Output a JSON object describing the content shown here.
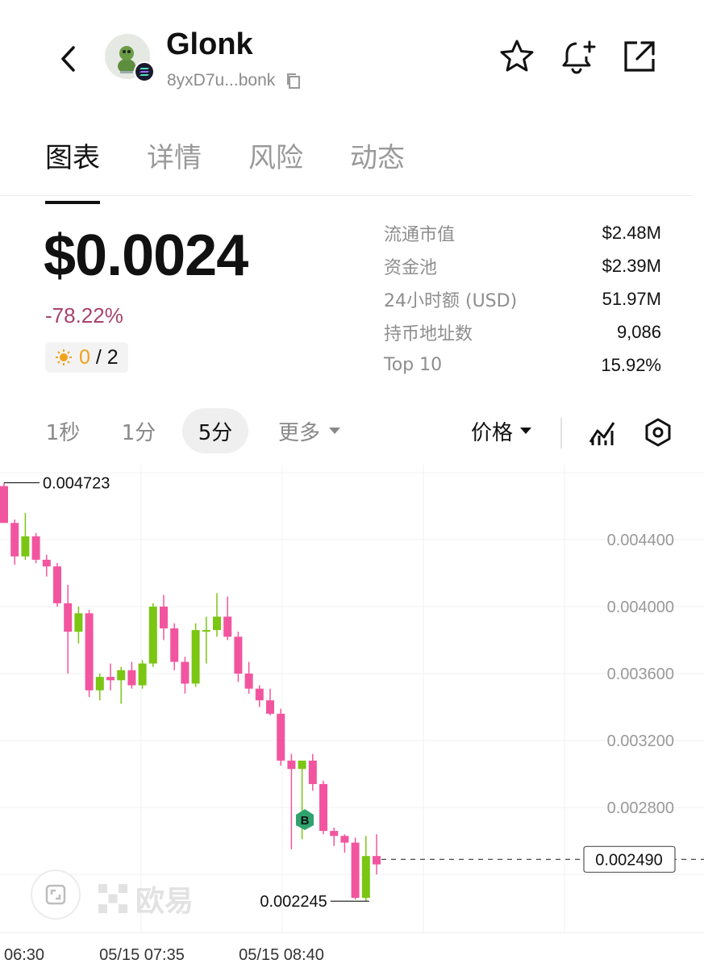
{
  "header": {
    "token_name": "Glonk",
    "address": "8yxD7u...bonk",
    "icons": [
      "back-icon",
      "token-avatar",
      "copy-icon",
      "star-icon",
      "bell-plus-icon",
      "share-icon"
    ]
  },
  "tabs": [
    {
      "label": "图表",
      "active": true
    },
    {
      "label": "详情",
      "active": false
    },
    {
      "label": "风险",
      "active": false
    },
    {
      "label": "动态",
      "active": false
    }
  ],
  "price_block": {
    "price": "$0.0024",
    "change": "-78.22%",
    "badge_num": "0",
    "badge_total": " / 2"
  },
  "stats": [
    {
      "label": "流通市值",
      "value": "$2.48M"
    },
    {
      "label": "资金池",
      "value": "$2.39M"
    },
    {
      "label": "24小时额 (USD)",
      "value": "51.97M"
    },
    {
      "label": "持币地址数",
      "value": "9,086"
    },
    {
      "label": "Top 10",
      "value": "15.92%"
    }
  ],
  "intervals": {
    "items": [
      {
        "label": "1秒",
        "active": false
      },
      {
        "label": "1分",
        "active": false
      },
      {
        "label": "5分",
        "active": true
      },
      {
        "label": "更多",
        "active": false
      }
    ],
    "price_dropdown": "价格"
  },
  "colors": {
    "up": "#7ac613",
    "down": "#f2559f",
    "change_negative": "#a8436e",
    "badge": "#f0a21b",
    "buy_marker": "#2fa36e"
  },
  "chart_data": {
    "type": "candlestick",
    "y_axis_ticks": [
      "0.004400",
      "0.004000",
      "0.003600",
      "0.003200",
      "0.002800"
    ],
    "x_axis_ticks": [
      "06:30",
      "05/15 07:35",
      "05/15 08:40"
    ],
    "high_label": "0.004723",
    "low_label": "0.002245",
    "current_price_label": "0.002490",
    "buy_marker_label": "B",
    "watermark": "欧易",
    "ylim": [
      0.00215,
      0.00492
    ],
    "candles": [
      {
        "o": 0.00472,
        "h": 0.00474,
        "c": 0.0045,
        "l": 0.0045
      },
      {
        "o": 0.0045,
        "h": 0.00452,
        "c": 0.0043,
        "l": 0.00425
      },
      {
        "o": 0.0043,
        "h": 0.00456,
        "c": 0.00442,
        "l": 0.00428
      },
      {
        "o": 0.00442,
        "h": 0.00444,
        "c": 0.00428,
        "l": 0.00426
      },
      {
        "o": 0.00428,
        "h": 0.00431,
        "c": 0.00424,
        "l": 0.00418
      },
      {
        "o": 0.00424,
        "h": 0.00426,
        "c": 0.00402,
        "l": 0.004
      },
      {
        "o": 0.00402,
        "h": 0.00413,
        "c": 0.00385,
        "l": 0.0036
      },
      {
        "o": 0.00385,
        "h": 0.004,
        "c": 0.00396,
        "l": 0.00378
      },
      {
        "o": 0.00396,
        "h": 0.00398,
        "c": 0.0035,
        "l": 0.00346
      },
      {
        "o": 0.0035,
        "h": 0.0036,
        "c": 0.00358,
        "l": 0.00344
      },
      {
        "o": 0.00358,
        "h": 0.00366,
        "c": 0.00356,
        "l": 0.0035
      },
      {
        "o": 0.00356,
        "h": 0.00364,
        "c": 0.00362,
        "l": 0.00342
      },
      {
        "o": 0.00362,
        "h": 0.00367,
        "c": 0.00353,
        "l": 0.00351
      },
      {
        "o": 0.00353,
        "h": 0.00368,
        "c": 0.00366,
        "l": 0.00351
      },
      {
        "o": 0.00366,
        "h": 0.00402,
        "c": 0.004,
        "l": 0.00364
      },
      {
        "o": 0.004,
        "h": 0.00407,
        "c": 0.00387,
        "l": 0.0038
      },
      {
        "o": 0.00387,
        "h": 0.0039,
        "c": 0.00367,
        "l": 0.00362
      },
      {
        "o": 0.00367,
        "h": 0.0037,
        "c": 0.00354,
        "l": 0.00348
      },
      {
        "o": 0.00354,
        "h": 0.0039,
        "c": 0.00386,
        "l": 0.00352
      },
      {
        "o": 0.00386,
        "h": 0.00394,
        "c": 0.00386,
        "l": 0.00366
      },
      {
        "o": 0.00386,
        "h": 0.00408,
        "c": 0.00394,
        "l": 0.00382
      },
      {
        "o": 0.00394,
        "h": 0.00406,
        "c": 0.00382,
        "l": 0.0038
      },
      {
        "o": 0.00382,
        "h": 0.00385,
        "c": 0.0036,
        "l": 0.00355
      },
      {
        "o": 0.0036,
        "h": 0.00367,
        "c": 0.00351,
        "l": 0.00348
      },
      {
        "o": 0.00351,
        "h": 0.00353,
        "c": 0.00344,
        "l": 0.0034
      },
      {
        "o": 0.00344,
        "h": 0.00351,
        "c": 0.00336,
        "l": 0.00335
      },
      {
        "o": 0.00336,
        "h": 0.00339,
        "c": 0.00308,
        "l": 0.00305
      },
      {
        "o": 0.00308,
        "h": 0.00312,
        "c": 0.00303,
        "l": 0.00255
      },
      {
        "o": 0.00303,
        "h": 0.00308,
        "c": 0.00308,
        "l": 0.00261
      },
      {
        "o": 0.00308,
        "h": 0.00312,
        "c": 0.00294,
        "l": 0.0029
      },
      {
        "o": 0.00294,
        "h": 0.00296,
        "c": 0.00266,
        "l": 0.00264
      },
      {
        "o": 0.00266,
        "h": 0.00268,
        "c": 0.00263,
        "l": 0.00257
      },
      {
        "o": 0.00263,
        "h": 0.00264,
        "c": 0.00259,
        "l": 0.00253
      },
      {
        "o": 0.00259,
        "h": 0.00262,
        "c": 0.00226,
        "l": 0.00225
      },
      {
        "o": 0.00226,
        "h": 0.00263,
        "c": 0.00251,
        "l": 0.00224
      },
      {
        "o": 0.00251,
        "h": 0.00264,
        "c": 0.00246,
        "l": 0.0024
      }
    ]
  }
}
